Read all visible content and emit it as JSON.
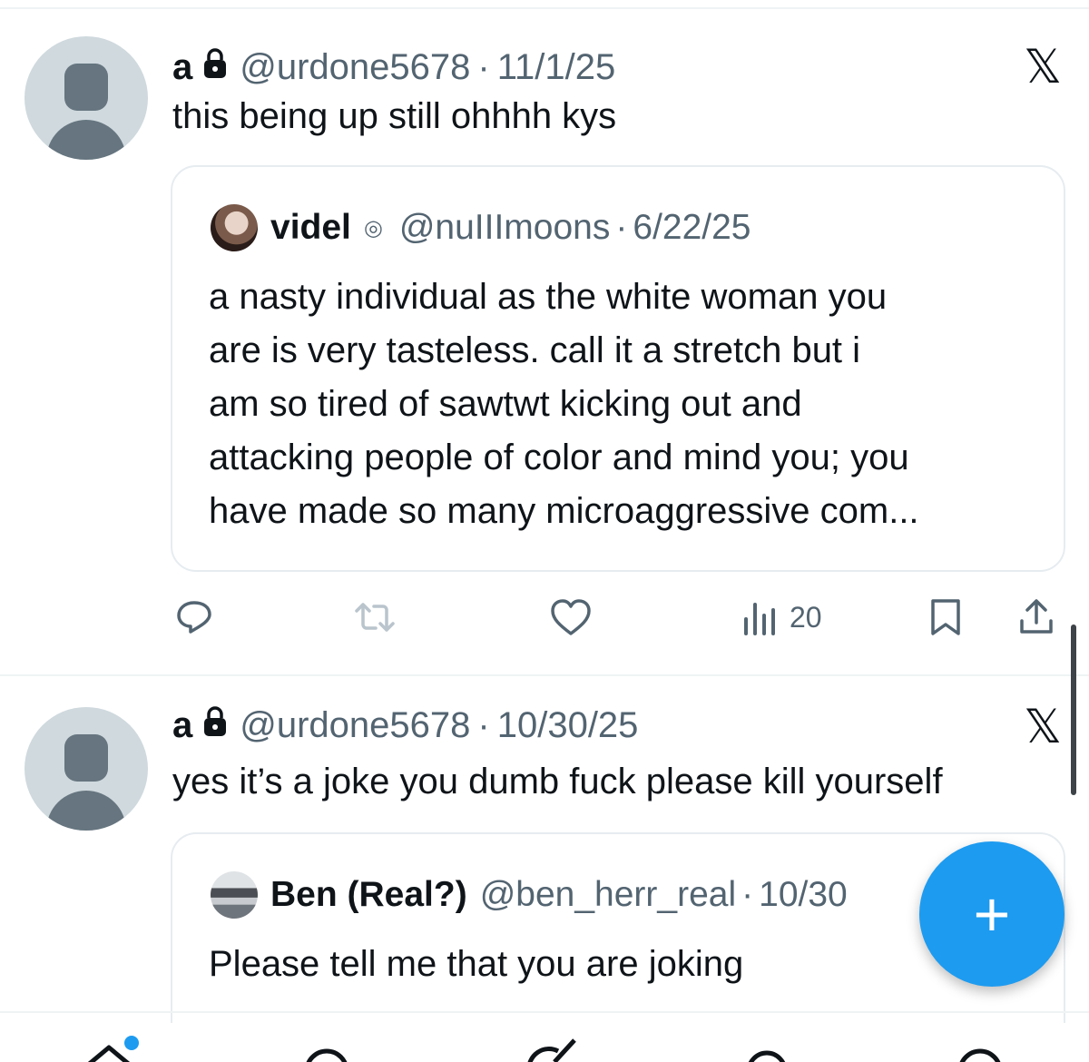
{
  "tweets": [
    {
      "name": "a",
      "handle": "@urdone5678",
      "separator": "·",
      "date": "11/1/25",
      "text": "this being up still ohhhh kys",
      "quote": {
        "name": "videl",
        "handle": "@nuIIImoons",
        "separator": "·",
        "date": "6/22/25",
        "text": "a nasty individual as the white woman you\nare is very tasteless. call it a stretch but i\nam so tired of sawtwt kicking out and\nattacking people of color and mind you; you\nhave made so many microaggressive com..."
      },
      "actions": {
        "views_count": "20"
      }
    },
    {
      "name": "a",
      "handle": "@urdone5678",
      "separator": "·",
      "date": "10/30/25",
      "text": "yes it’s a joke you dumb fuck please kill yourself",
      "quote": {
        "name": "Ben (Real?)",
        "handle": "@ben_herr_real",
        "separator": "·",
        "date": "10/30",
        "text": "Please tell me that you are joking"
      }
    }
  ],
  "fab": {
    "label": "+"
  },
  "colors": {
    "accent": "#1d9bf0",
    "secondary_text": "#536471",
    "primary_text": "#0f1419",
    "avatar_placeholder": "#cfd9de"
  },
  "icons": [
    "lock-icon",
    "x-logo-icon",
    "reply-icon",
    "retweet-icon",
    "like-icon",
    "views-icon",
    "bookmark-icon",
    "share-icon",
    "home-icon",
    "search-icon",
    "grok-icon",
    "notifications-icon",
    "messages-icon"
  ]
}
